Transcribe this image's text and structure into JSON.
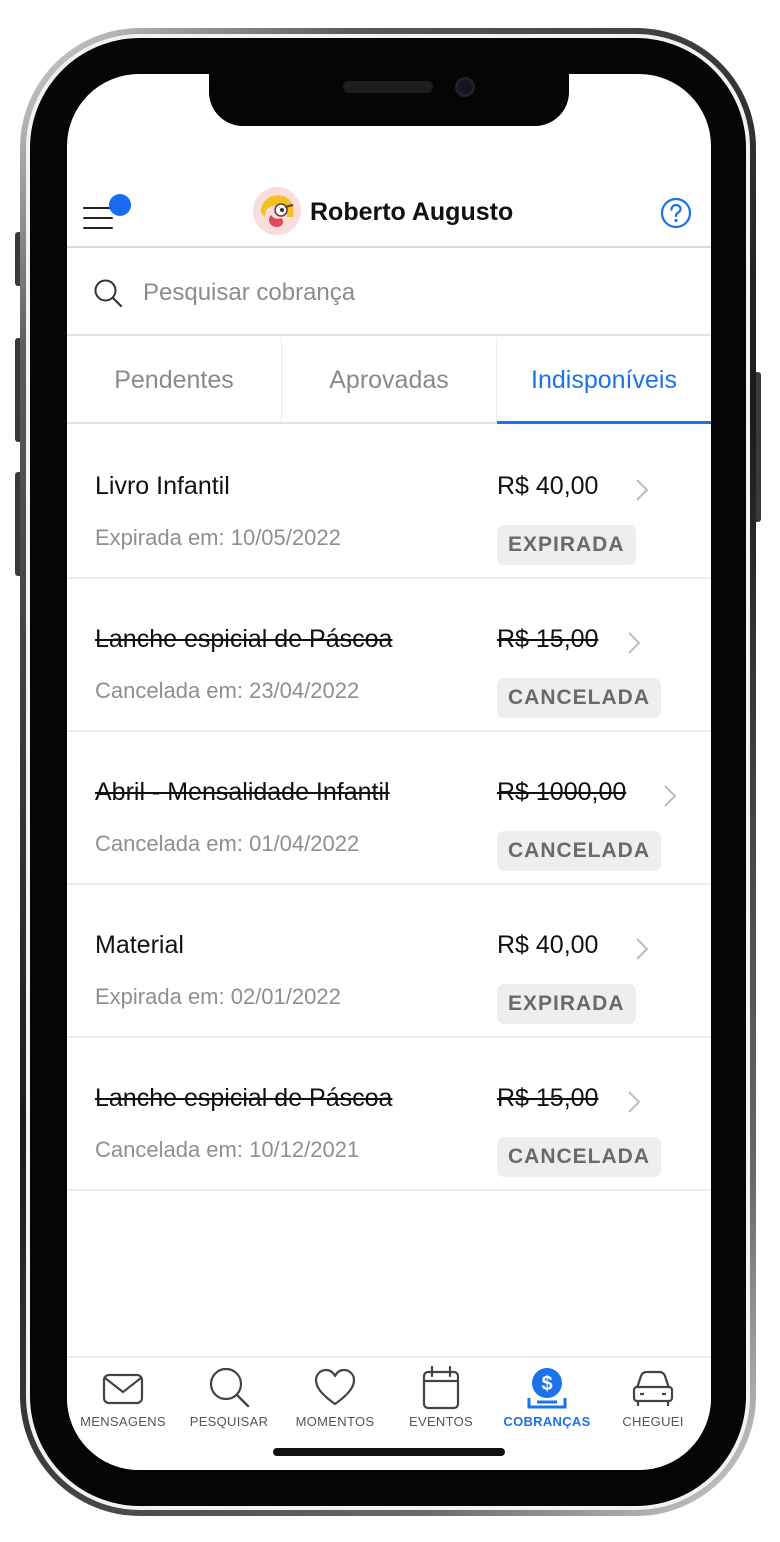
{
  "header": {
    "user_name": "Roberto Augusto",
    "menu_has_notification": true,
    "accent_color": "#1a6bf0"
  },
  "search": {
    "placeholder": "Pesquisar cobrança"
  },
  "tabs": [
    {
      "label": "Pendentes",
      "active": false
    },
    {
      "label": "Aprovadas",
      "active": false
    },
    {
      "label": "Indisponíveis",
      "active": true
    }
  ],
  "charges": [
    {
      "title": "Livro Infantil",
      "date": "Expirada em: 10/05/2022",
      "price": "R$ 40,00",
      "status": "EXPIRADA",
      "struck": false
    },
    {
      "title": "Lanche espicial de Páscoa",
      "date": "Cancelada em: 23/04/2022",
      "price": "R$ 15,00",
      "status": "CANCELADA",
      "struck": true
    },
    {
      "title": "Abril - Mensalidade Infantil",
      "date": "Cancelada em: 01/04/2022",
      "price": "R$ 1000,00",
      "status": "CANCELADA",
      "struck": true
    },
    {
      "title": "Material",
      "date": "Expirada em: 02/01/2022",
      "price": "R$ 40,00",
      "status": "EXPIRADA",
      "struck": false
    },
    {
      "title": "Lanche espicial de Páscoa",
      "date": "Cancelada em: 10/12/2021",
      "price": "R$ 15,00",
      "status": "CANCELADA",
      "struck": true
    }
  ],
  "bottom_nav": [
    {
      "label": "MENSAGENS",
      "icon": "envelope-icon",
      "active": false
    },
    {
      "label": "PESQUISAR",
      "icon": "search-icon",
      "active": false
    },
    {
      "label": "MOMENTOS",
      "icon": "heart-icon",
      "active": false
    },
    {
      "label": "EVENTOS",
      "icon": "calendar-icon",
      "active": false
    },
    {
      "label": "COBRANÇAS",
      "icon": "dollar-icon",
      "active": true
    },
    {
      "label": "CHEGUEI",
      "icon": "car-icon",
      "active": false
    }
  ],
  "colors": {
    "active_tab": "#1a73e8",
    "badge_bg": "#eeeeee",
    "badge_text": "#6a6a6a"
  }
}
